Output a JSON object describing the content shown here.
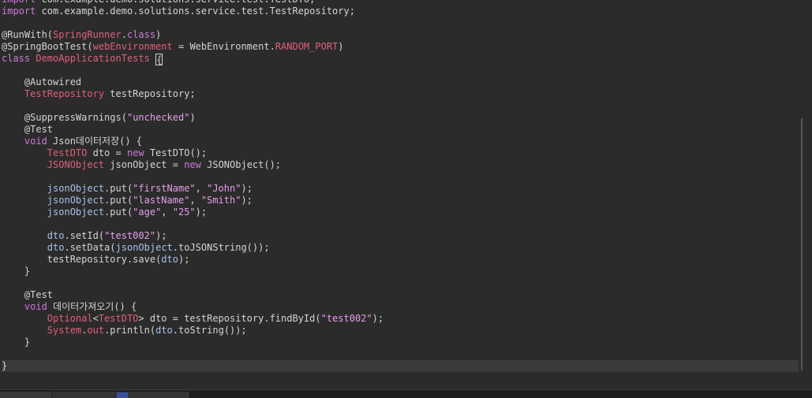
{
  "editor": {
    "lines": [
      {
        "tokens": [
          [
            "kw",
            "import"
          ],
          [
            "pl",
            " com.example.demo.solutions.service.test.TestDTO;"
          ]
        ]
      },
      {
        "tokens": [
          [
            "kw",
            "import"
          ],
          [
            "pl",
            " com.example.demo.solutions.service.test.TestRepository;"
          ]
        ]
      },
      {
        "tokens": [
          [
            "pl",
            ""
          ]
        ]
      },
      {
        "tokens": [
          [
            "an",
            "@RunWith"
          ],
          [
            "pl",
            "("
          ],
          [
            "ty",
            "SpringRunner"
          ],
          [
            "pl",
            "."
          ],
          [
            "kw",
            "class"
          ],
          [
            "pl",
            ")"
          ]
        ]
      },
      {
        "tokens": [
          [
            "an",
            "@SpringBootTest"
          ],
          [
            "pl",
            "("
          ],
          [
            "ty",
            "webEnvironment"
          ],
          [
            "pl",
            " = WebEnvironment."
          ],
          [
            "ty",
            "RANDOM_PORT"
          ],
          [
            "pl",
            ")"
          ]
        ]
      },
      {
        "tokens": [
          [
            "kw",
            "class"
          ],
          [
            "pl",
            " "
          ],
          [
            "ty",
            "DemoApplicationTests"
          ],
          [
            "pl",
            " "
          ],
          [
            "cursor",
            "{"
          ]
        ]
      },
      {
        "tokens": [
          [
            "pl",
            ""
          ]
        ]
      },
      {
        "tokens": [
          [
            "pl",
            "    "
          ],
          [
            "an",
            "@Autowired"
          ]
        ]
      },
      {
        "tokens": [
          [
            "pl",
            "    "
          ],
          [
            "ty",
            "TestRepository"
          ],
          [
            "pl",
            " testRepository;"
          ]
        ]
      },
      {
        "tokens": [
          [
            "pl",
            ""
          ]
        ]
      },
      {
        "tokens": [
          [
            "pl",
            "    "
          ],
          [
            "an",
            "@SuppressWarnings"
          ],
          [
            "pl",
            "("
          ],
          [
            "st",
            "\"unchecked\""
          ],
          [
            "pl",
            ")"
          ]
        ]
      },
      {
        "tokens": [
          [
            "pl",
            "    "
          ],
          [
            "an",
            "@Test"
          ]
        ]
      },
      {
        "tokens": [
          [
            "pl",
            "    "
          ],
          [
            "kw",
            "void"
          ],
          [
            "pl",
            " Json데이터저장() {"
          ]
        ]
      },
      {
        "tokens": [
          [
            "pl",
            "        "
          ],
          [
            "ty",
            "TestDTO"
          ],
          [
            "pl",
            " dto = "
          ],
          [
            "kw",
            "new"
          ],
          [
            "pl",
            " TestDTO();"
          ]
        ]
      },
      {
        "tokens": [
          [
            "pl",
            "        "
          ],
          [
            "ty",
            "JSONObject"
          ],
          [
            "pl",
            " jsonObject = "
          ],
          [
            "kw",
            "new"
          ],
          [
            "pl",
            " JSONObject();"
          ]
        ]
      },
      {
        "tokens": [
          [
            "pl",
            ""
          ]
        ]
      },
      {
        "tokens": [
          [
            "pl",
            "        "
          ],
          [
            "vr",
            "jsonObject"
          ],
          [
            "pl",
            ".put("
          ],
          [
            "st",
            "\"firstName\""
          ],
          [
            "pl",
            ", "
          ],
          [
            "st",
            "\"John\""
          ],
          [
            "pl",
            ");"
          ]
        ]
      },
      {
        "tokens": [
          [
            "pl",
            "        "
          ],
          [
            "vr",
            "jsonObject"
          ],
          [
            "pl",
            ".put("
          ],
          [
            "st",
            "\"lastName\""
          ],
          [
            "pl",
            ", "
          ],
          [
            "st",
            "\"Smith\""
          ],
          [
            "pl",
            ");"
          ]
        ]
      },
      {
        "tokens": [
          [
            "pl",
            "        "
          ],
          [
            "vr",
            "jsonObject"
          ],
          [
            "pl",
            ".put("
          ],
          [
            "st",
            "\"age\""
          ],
          [
            "pl",
            ", "
          ],
          [
            "st",
            "\"25\""
          ],
          [
            "pl",
            ");"
          ]
        ]
      },
      {
        "tokens": [
          [
            "pl",
            ""
          ]
        ]
      },
      {
        "tokens": [
          [
            "pl",
            "        "
          ],
          [
            "vr",
            "dto"
          ],
          [
            "pl",
            ".setId("
          ],
          [
            "st",
            "\"test002\""
          ],
          [
            "pl",
            ");"
          ]
        ]
      },
      {
        "tokens": [
          [
            "pl",
            "        "
          ],
          [
            "vr",
            "dto"
          ],
          [
            "pl",
            ".setData("
          ],
          [
            "vr",
            "jsonObject"
          ],
          [
            "pl",
            ".toJSONString());"
          ]
        ]
      },
      {
        "tokens": [
          [
            "pl",
            "        testRepository.save("
          ],
          [
            "vr",
            "dto"
          ],
          [
            "pl",
            ");"
          ]
        ]
      },
      {
        "tokens": [
          [
            "pl",
            "    }"
          ]
        ]
      },
      {
        "tokens": [
          [
            "pl",
            ""
          ]
        ]
      },
      {
        "tokens": [
          [
            "pl",
            "    "
          ],
          [
            "an",
            "@Test"
          ]
        ]
      },
      {
        "tokens": [
          [
            "pl",
            "    "
          ],
          [
            "kw",
            "void"
          ],
          [
            "pl",
            " 데이터가져오기() {"
          ]
        ]
      },
      {
        "tokens": [
          [
            "pl",
            "        "
          ],
          [
            "ty",
            "Optional"
          ],
          [
            "pl",
            "<"
          ],
          [
            "ty",
            "TestDTO"
          ],
          [
            "pl",
            "> dto = testRepository.findById("
          ],
          [
            "st",
            "\"test002\""
          ],
          [
            "pl",
            ");"
          ]
        ]
      },
      {
        "tokens": [
          [
            "pl",
            "        "
          ],
          [
            "ty",
            "System"
          ],
          [
            "pl",
            "."
          ],
          [
            "ty",
            "out"
          ],
          [
            "pl",
            ".println("
          ],
          [
            "vr",
            "dto"
          ],
          [
            "pl",
            ".toString());"
          ]
        ]
      },
      {
        "tokens": [
          [
            "pl",
            "    }"
          ]
        ]
      },
      {
        "tokens": [
          [
            "pl",
            ""
          ]
        ]
      },
      {
        "tokens": [
          [
            "pl",
            "}"
          ]
        ],
        "current": true
      }
    ]
  },
  "colors": {
    "background": "#2b2b2b",
    "keyword": "#cc7ad8",
    "type": "#e0607a",
    "string": "#e3a0e8",
    "plain": "#d4d4d4"
  }
}
